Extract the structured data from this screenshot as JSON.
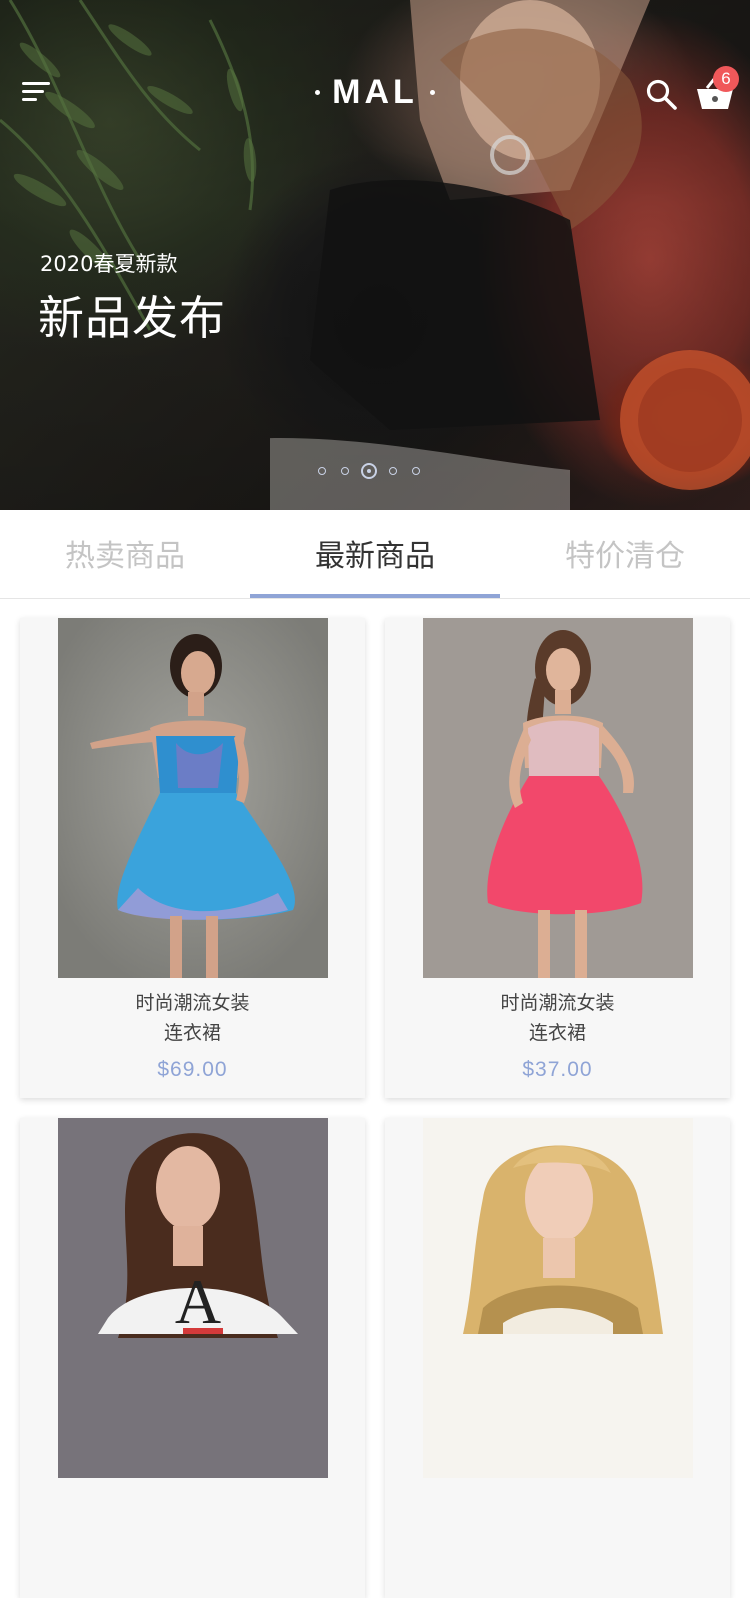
{
  "header": {
    "logo_text": "MAL",
    "cart_count": "6",
    "icons": {
      "menu": "menu-icon",
      "search": "search-icon",
      "cart": "basket-icon"
    }
  },
  "hero": {
    "subtitle": "2020春夏新款",
    "title": "新品发布",
    "slides_total": 5,
    "active_slide": 3
  },
  "tabs": [
    {
      "label": "热卖商品",
      "active": false
    },
    {
      "label": "最新商品",
      "active": true
    },
    {
      "label": "特价清仓",
      "active": false
    }
  ],
  "products": [
    {
      "name_line1": "时尚潮流女装",
      "name_line2": "连衣裙",
      "price": "$69.00"
    },
    {
      "name_line1": "时尚潮流女装",
      "name_line2": "连衣裙",
      "price": "$37.00"
    },
    {
      "name_line1": "",
      "name_line2": "",
      "price": ""
    },
    {
      "name_line1": "",
      "name_line2": "",
      "price": ""
    }
  ],
  "colors": {
    "accent": "#8fa4d6",
    "badge": "#f0585a",
    "tab_inactive": "#c4c4c4",
    "tab_active": "#333333",
    "card_bg": "#f7f7f7"
  }
}
